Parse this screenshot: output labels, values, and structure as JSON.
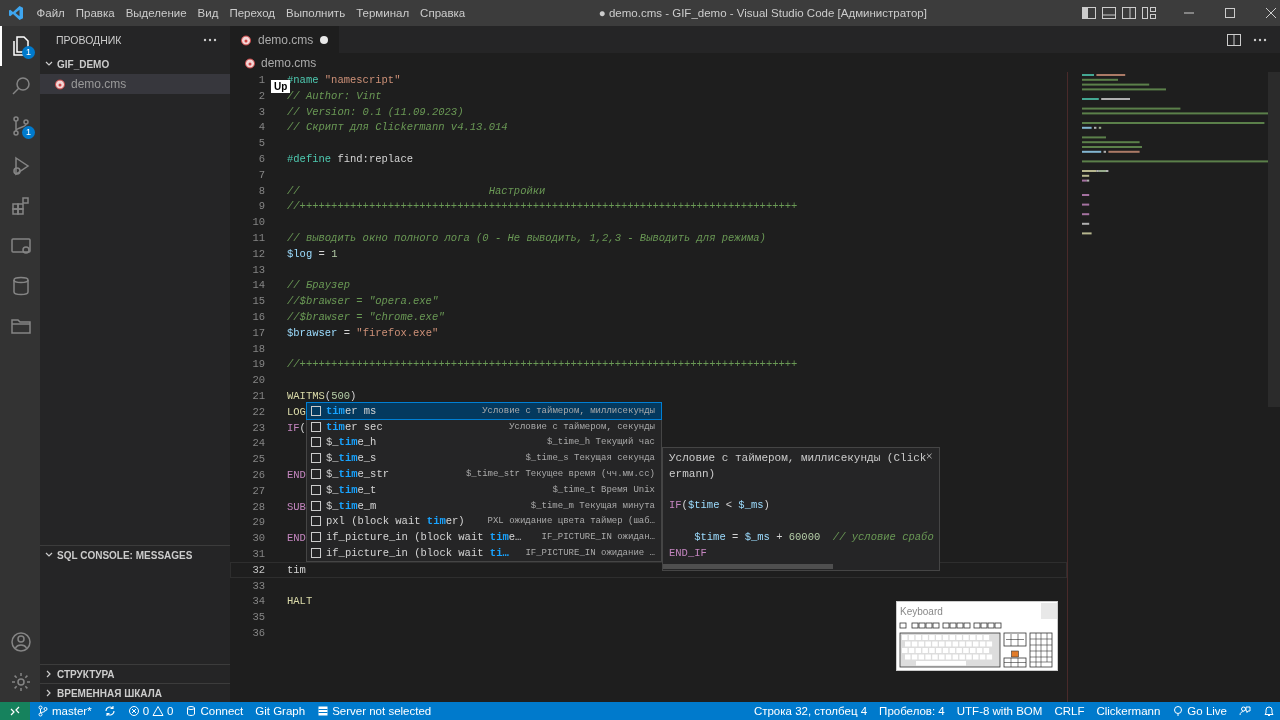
{
  "title_bar": {
    "menu": [
      "Файл",
      "Правка",
      "Выделение",
      "Вид",
      "Переход",
      "Выполнить",
      "Терминал",
      "Справка"
    ],
    "title": "● demo.cms - GIF_demo - Visual Studio Code [Администратор]"
  },
  "activity_bar": {
    "top": [
      {
        "kind": "files",
        "selected": true,
        "badge": "1"
      },
      {
        "kind": "search",
        "selected": false
      },
      {
        "kind": "source-control",
        "selected": false,
        "badge": "1"
      },
      {
        "kind": "debug",
        "selected": false
      },
      {
        "kind": "extensions",
        "selected": false
      },
      {
        "kind": "remote",
        "selected": false
      },
      {
        "kind": "database",
        "selected": false
      },
      {
        "kind": "folder",
        "selected": false
      }
    ],
    "bottom": [
      {
        "kind": "account"
      },
      {
        "kind": "settings"
      }
    ]
  },
  "sidebar": {
    "title": "ПРОВОДНИК",
    "folder": {
      "name": "GIF_DEMO",
      "expanded": true,
      "files": [
        {
          "name": "demo.cms",
          "selected": true
        }
      ]
    },
    "sections": [
      {
        "title": "SQL CONSOLE: MESSAGES",
        "expanded": true
      },
      {
        "title": "СТРУКТУРА",
        "expanded": false
      },
      {
        "title": "ВРЕМЕННАЯ ШКАЛА",
        "expanded": false
      }
    ]
  },
  "tabs": [
    {
      "label": "demo.cms",
      "selected": true,
      "modified": true
    }
  ],
  "breadcrumb": "demo.cms",
  "editor": {
    "lines": [
      {
        "number": "1",
        "current": false,
        "tokens": [
          {
            "kind": "directive",
            "text": "#name"
          },
          {
            "kind": "string",
            "text": " \"namescript\""
          }
        ]
      },
      {
        "number": "2",
        "current": false,
        "tokens": [
          {
            "kind": "comment",
            "text": "// Author: Vint"
          }
        ]
      },
      {
        "number": "3",
        "current": false,
        "tokens": [
          {
            "kind": "comment",
            "text": "// Version: 0.1 (11.09.2023)"
          }
        ]
      },
      {
        "number": "4",
        "current": false,
        "tokens": [
          {
            "kind": "comment",
            "text": "// Скрипт для Clickermann v4.13.014"
          }
        ]
      },
      {
        "number": "5",
        "current": false
      },
      {
        "number": "6",
        "current": false,
        "tokens": [
          {
            "kind": "directive",
            "text": "#define"
          },
          {
            "kind": "plain",
            "text": " find:replace"
          }
        ]
      },
      {
        "number": "7",
        "current": false
      },
      {
        "number": "8",
        "current": false,
        "tokens": [
          {
            "kind": "comment",
            "text": "//                              Настройки"
          }
        ]
      },
      {
        "number": "9",
        "current": false,
        "tokens": [
          {
            "kind": "comment",
            "text": "//+++++++++++++++++++++++++++++++++++++++++++++++++++++++++++++++++++++++++++++++"
          }
        ]
      },
      {
        "number": "10",
        "current": false
      },
      {
        "number": "11",
        "current": false,
        "tokens": [
          {
            "kind": "comment",
            "text": "// выводить окно полного лога (0 - Не выводить, 1,2,3 - Выводить для режима)"
          }
        ]
      },
      {
        "number": "12",
        "current": false,
        "tokens": [
          {
            "kind": "variable",
            "text": "$log"
          },
          {
            "kind": "plain",
            "text": " = "
          },
          {
            "kind": "number",
            "text": "1"
          }
        ]
      },
      {
        "number": "13",
        "current": false
      },
      {
        "number": "14",
        "current": false,
        "tokens": [
          {
            "kind": "comment",
            "text": "// Браузер"
          }
        ]
      },
      {
        "number": "15",
        "current": false,
        "tokens": [
          {
            "kind": "comment",
            "text": "//$brawser = \"opera.exe\""
          }
        ]
      },
      {
        "number": "16",
        "current": false,
        "tokens": [
          {
            "kind": "comment",
            "text": "//$brawser = \"chrome.exe\""
          }
        ]
      },
      {
        "number": "17",
        "current": false,
        "tokens": [
          {
            "kind": "variable",
            "text": "$brawser"
          },
          {
            "kind": "plain",
            "text": " = "
          },
          {
            "kind": "string",
            "text": "\"firefox.exe\""
          }
        ]
      },
      {
        "number": "18",
        "current": false
      },
      {
        "number": "19",
        "current": false,
        "tokens": [
          {
            "kind": "comment",
            "text": "//+++++++++++++++++++++++++++++++++++++++++++++++++++++++++++++++++++++++++++++++"
          }
        ]
      },
      {
        "number": "20",
        "current": false
      },
      {
        "number": "21",
        "current": false,
        "tokens": [
          {
            "kind": "function",
            "text": "WAITMS"
          },
          {
            "kind": "plain",
            "text": "("
          },
          {
            "kind": "number",
            "text": "500"
          },
          {
            "kind": "plain",
            "text": ")"
          }
        ]
      },
      {
        "number": "22",
        "current": false,
        "tokens": [
          {
            "kind": "function",
            "text": "LOG"
          }
        ]
      },
      {
        "number": "23",
        "current": false,
        "tokens": [
          {
            "kind": "keyword",
            "text": "IF"
          },
          {
            "kind": "plain",
            "text": "("
          }
        ]
      },
      {
        "number": "24",
        "current": false
      },
      {
        "number": "25",
        "current": false
      },
      {
        "number": "26",
        "current": false,
        "tokens": [
          {
            "kind": "keyword",
            "text": "END"
          }
        ]
      },
      {
        "number": "27",
        "current": false
      },
      {
        "number": "28",
        "current": false,
        "tokens": [
          {
            "kind": "keyword",
            "text": "SUB"
          }
        ]
      },
      {
        "number": "29",
        "current": false
      },
      {
        "number": "30",
        "current": false,
        "tokens": [
          {
            "kind": "keyword",
            "text": "END"
          }
        ]
      },
      {
        "number": "31",
        "current": false
      },
      {
        "number": "32",
        "current": true,
        "tokens": [
          {
            "kind": "plain",
            "text": "tim"
          }
        ]
      },
      {
        "number": "33",
        "current": false
      },
      {
        "number": "34",
        "current": false,
        "tokens": [
          {
            "kind": "function",
            "text": "HALT"
          }
        ]
      },
      {
        "number": "35",
        "current": false
      },
      {
        "number": "36",
        "current": false
      }
    ]
  },
  "tooltip": "Up",
  "suggest": {
    "items": [
      {
        "selected": true,
        "label": [
          {
            "text": "tim",
            "match": true
          },
          {
            "text": "er ms",
            "match": false
          }
        ],
        "detail": "Условие с таймером, миллисекунды"
      },
      {
        "selected": false,
        "label": [
          {
            "text": "tim",
            "match": true
          },
          {
            "text": "er sec",
            "match": false
          }
        ],
        "detail": "Условие с таймером, секунды"
      },
      {
        "selected": false,
        "label": [
          {
            "text": "$_",
            "match": false
          },
          {
            "text": "tim",
            "match": true
          },
          {
            "text": "e_h",
            "match": false
          }
        ],
        "detail": "$_time_h Текущий час"
      },
      {
        "selected": false,
        "label": [
          {
            "text": "$_",
            "match": false
          },
          {
            "text": "tim",
            "match": true
          },
          {
            "text": "e_s",
            "match": false
          }
        ],
        "detail": "$_time_s Текущая секунда"
      },
      {
        "selected": false,
        "label": [
          {
            "text": "$_",
            "match": false
          },
          {
            "text": "tim",
            "match": true
          },
          {
            "text": "e_str",
            "match": false
          }
        ],
        "detail": "$_time_str Текущее время (чч.мм.сс)"
      },
      {
        "selected": false,
        "label": [
          {
            "text": "$_",
            "match": false
          },
          {
            "text": "tim",
            "match": true
          },
          {
            "text": "e_t",
            "match": false
          }
        ],
        "detail": "$_time_t Время Unix"
      },
      {
        "selected": false,
        "label": [
          {
            "text": "$_",
            "match": false
          },
          {
            "text": "tim",
            "match": true
          },
          {
            "text": "e_m",
            "match": false
          }
        ],
        "detail": "$_time_m Текущая минута"
      },
      {
        "selected": false,
        "label": [
          {
            "text": "pxl (block wait ",
            "match": false
          },
          {
            "text": "tim",
            "match": true
          },
          {
            "text": "er)",
            "match": false
          }
        ],
        "detail": "PXL ожидание цвета таймер (шаб…"
      },
      {
        "selected": false,
        "label": [
          {
            "text": "if_picture_in (block wait ",
            "match": false
          },
          {
            "text": "tim",
            "match": true
          },
          {
            "text": "e…",
            "match": false
          }
        ],
        "detail": "IF_PICTURE_IN ожидан…"
      },
      {
        "selected": false,
        "label": [
          {
            "text": "if_picture_in (block wait ",
            "match": false
          },
          {
            "text": "ti…",
            "match": true
          }
        ],
        "detail": "IF_PICTURE_IN ожидание …"
      }
    ],
    "details": {
      "description": [
        "Условие с таймером, миллисекунды (Click",
        "ermann)"
      ],
      "code": [
        {
          "gap_before": true,
          "tokens": [
            {
              "kind": "keyword",
              "text": "IF"
            },
            {
              "kind": "plain",
              "text": "("
            },
            {
              "kind": "variable",
              "text": "$time"
            },
            {
              "kind": "plain",
              "text": " < "
            },
            {
              "kind": "variable",
              "text": "$_ms"
            },
            {
              "kind": "plain",
              "text": ")"
            }
          ]
        },
        {
          "gap_before": true,
          "tokens": [
            {
              "kind": "variable",
              "text": "    $time"
            },
            {
              "kind": "plain",
              "text": " = "
            },
            {
              "kind": "variable",
              "text": "$_ms"
            },
            {
              "kind": "plain",
              "text": " + "
            },
            {
              "kind": "number",
              "text": "60000"
            },
            {
              "kind": "comment",
              "text": "  // условие срабо"
            }
          ]
        },
        {
          "gap_before": false,
          "tokens": [
            {
              "kind": "keyword",
              "text": "END_IF"
            }
          ]
        }
      ]
    }
  },
  "keyboard_window": {
    "title": "Keyboard"
  },
  "status_bar": {
    "left": [
      {
        "kind": "remote"
      },
      {
        "kind": "branch",
        "text": "master*"
      },
      {
        "kind": "sync"
      },
      {
        "kind": "problems",
        "errors": "0",
        "warnings": "0"
      },
      {
        "kind": "database",
        "text": "Connect"
      },
      {
        "kind": "text",
        "text": "Git Graph"
      },
      {
        "kind": "server",
        "text": "Server not selected"
      }
    ],
    "right": [
      {
        "kind": "text",
        "text": "Строка 32, столбец 4"
      },
      {
        "kind": "text",
        "text": "Пробелов: 4"
      },
      {
        "kind": "text",
        "text": "UTF-8 with BOM"
      },
      {
        "kind": "text",
        "text": "CRLF"
      },
      {
        "kind": "text",
        "text": "Clickermann"
      },
      {
        "kind": "live",
        "text": "Go Live"
      },
      {
        "kind": "feedback"
      },
      {
        "kind": "bell"
      }
    ]
  }
}
